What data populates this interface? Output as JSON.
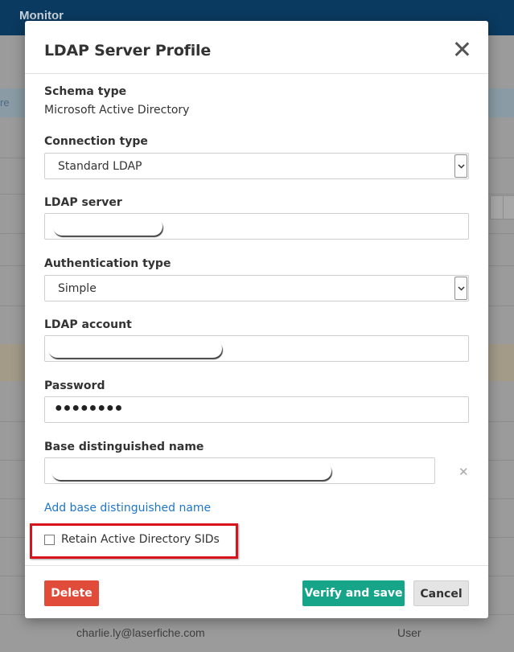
{
  "background": {
    "topbar_title": "Monitor",
    "header_fragment": "re",
    "bottom_row": {
      "email": "charlie.ly@laserfiche.com",
      "role": "User"
    }
  },
  "modal": {
    "title": "LDAP Server Profile",
    "fields": {
      "schema_type": {
        "label": "Schema type",
        "value": "Microsoft Active Directory"
      },
      "connection_type": {
        "label": "Connection type",
        "value": "Standard LDAP"
      },
      "ldap_server": {
        "label": "LDAP server",
        "value": ""
      },
      "authentication_type": {
        "label": "Authentication type",
        "value": "Simple"
      },
      "ldap_account": {
        "label": "LDAP account",
        "value": ""
      },
      "password": {
        "label": "Password",
        "value": "●●●●●●●●"
      },
      "base_dn": {
        "label": "Base distinguished name",
        "value": ""
      }
    },
    "add_base_dn_link": "Add base distinguished name",
    "retain_sids": {
      "label": "Retain Active Directory SIDs",
      "checked": false
    },
    "buttons": {
      "delete": "Delete",
      "verify_save": "Verify and save",
      "cancel": "Cancel"
    },
    "colors": {
      "delete": "#e04b3a",
      "save": "#17a58a",
      "highlight": "#d8131b",
      "link": "#1f76c8"
    }
  }
}
